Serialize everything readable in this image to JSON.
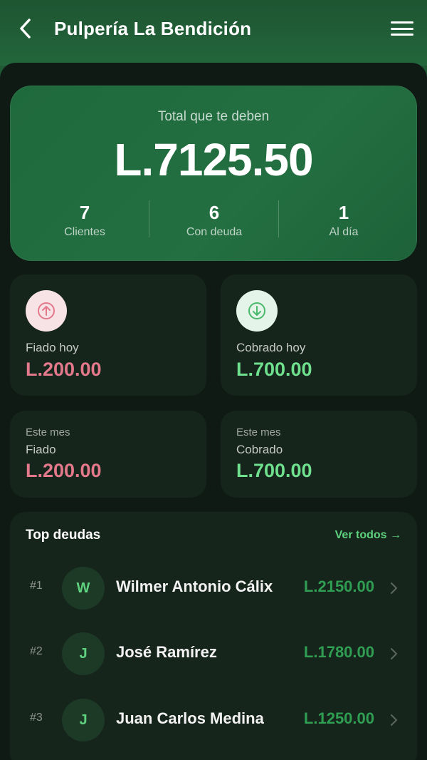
{
  "header": {
    "title": "Pulpería La Bendición"
  },
  "summary": {
    "label": "Total que te deben",
    "amount": "L.7125.50",
    "stats": [
      {
        "value": "7",
        "label": "Clientes"
      },
      {
        "value": "6",
        "label": "Con deuda"
      },
      {
        "value": "1",
        "label": "Al día"
      }
    ]
  },
  "today": {
    "fiado": {
      "label": "Fiado hoy",
      "amount": "L.200.00"
    },
    "cobrado": {
      "label": "Cobrado hoy",
      "amount": "L.700.00"
    }
  },
  "month": {
    "fiado": {
      "sub": "Este mes",
      "label": "Fiado",
      "amount": "L.200.00"
    },
    "cobrado": {
      "sub": "Este mes",
      "label": "Cobrado",
      "amount": "L.700.00"
    }
  },
  "top_debts": {
    "title": "Top deudas",
    "see_all": "Ver todos →",
    "items": [
      {
        "rank": "#1",
        "initial": "W",
        "name": "Wilmer Antonio Cálix",
        "amount": "L.2150.00"
      },
      {
        "rank": "#2",
        "initial": "J",
        "name": "José Ramírez",
        "amount": "L.1780.00"
      },
      {
        "rank": "#3",
        "initial": "J",
        "name": "Juan Carlos Medina",
        "amount": "L.1250.00"
      }
    ]
  },
  "colors": {
    "brand_green": "#236f41",
    "background": "#0f1a14",
    "debt_red": "#e3798b",
    "paid_green": "#6fe08d"
  },
  "icons": {
    "back": "chevron-left-icon",
    "menu": "hamburger-menu-icon",
    "fiado": "arrow-up-circle-icon",
    "cobrado": "arrow-down-circle-icon",
    "row": "chevron-right-icon"
  }
}
